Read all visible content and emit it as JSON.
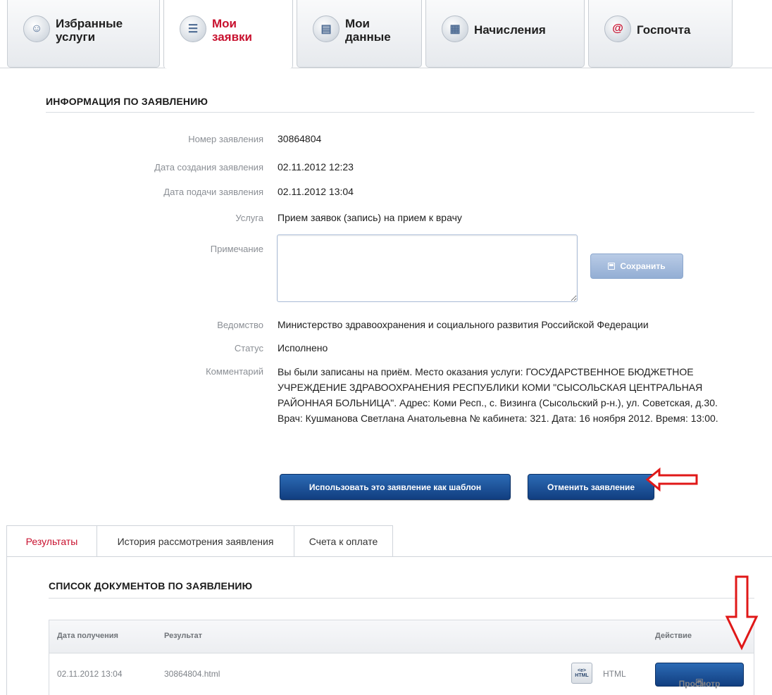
{
  "top_tabs": [
    {
      "label": "Избранные\nуслуги",
      "icon": "person-icon"
    },
    {
      "label": "Мои\nзаявки",
      "icon": "list-icon"
    },
    {
      "label": "Мои\nданные",
      "icon": "book-icon"
    },
    {
      "label": "Начисления",
      "icon": "calculator-icon"
    },
    {
      "label": "Госпочта",
      "icon": "at-icon"
    }
  ],
  "info": {
    "title": "ИНФОРМАЦИЯ ПО ЗАЯВЛЕНИЮ",
    "rows": [
      {
        "label": "Номер заявления",
        "value": "30864804"
      },
      {
        "label": "Дата создания заявления",
        "value": "02.11.2012 12:23"
      },
      {
        "label": "Дата подачи заявления",
        "value": "02.11.2012 13:04"
      },
      {
        "label": "Услуга",
        "value": "Прием заявок (запись) на прием к врачу"
      }
    ],
    "note_label": "Примечание",
    "note_value": "",
    "save_label": "Сохранить",
    "agency_label": "Ведомство",
    "agency_value": "Министерство здравоохранения и социального развития Российской Федерации",
    "status_label": "Статус",
    "status_value": "Исполнено",
    "comment_label": "Комментарий",
    "comment_value": "Вы были записаны на приём. Место оказания услуги: ГОСУДАРСТВЕННОЕ БЮДЖЕТНОЕ УЧРЕЖДЕНИЕ ЗДРАВООХРАНЕНИЯ РЕСПУБЛИКИ КОМИ \"СЫСОЛЬСКАЯ ЦЕНТРАЛЬНАЯ РАЙОННАЯ БОЛЬНИЦА\". Адрес: Коми Респ., с. Визинга (Сысольский р-н.), ул. Советская, д.30. Врач: Кушманова Светлана Анатольевна № кабинета: 321. Дата: 16 ноября 2012. Время: 13:00.",
    "template_button": "Использовать это заявление как шаблон",
    "cancel_button": "Отменить заявление"
  },
  "lower_tabs": [
    "Результаты",
    "История рассмотрения заявления",
    "Счета к оплате"
  ],
  "documents": {
    "title": "СПИСОК ДОКУМЕНТОВ ПО ЗАЯВЛЕНИЮ",
    "columns": [
      "Дата получения",
      "Результат",
      "Действие"
    ],
    "rows": [
      {
        "date": "02.11.2012 13:04",
        "file": "30864804.html",
        "format_icon_text": "HTML",
        "format": "HTML",
        "action": "Просмотр"
      }
    ]
  },
  "colors": {
    "accent_red": "#c8102e",
    "button_blue": "#1a4f96",
    "annotation_arrow": "#e01818"
  }
}
